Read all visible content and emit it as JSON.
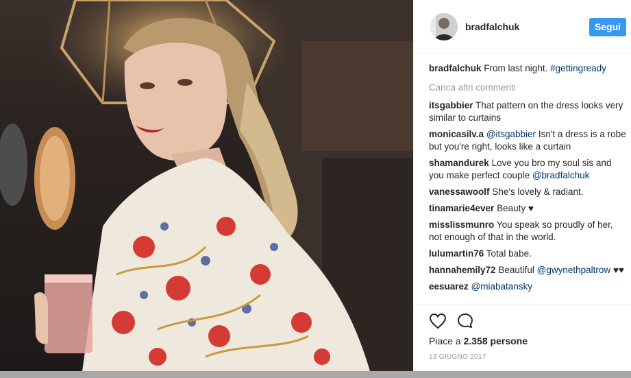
{
  "post": {
    "username": "bradfalchuk",
    "follow_label": "Segui",
    "caption_user": "bradfalchuk",
    "caption_text": "From last night. ",
    "caption_tag": "#gettingready",
    "load_more": "Carica altri commenti",
    "likes_prefix": "Piace a ",
    "likes_count": "2.358",
    "likes_suffix": " persone",
    "date": "13 GIUGNO 2017"
  },
  "comments": [
    {
      "user": "itsgabbier",
      "pre": "",
      "mention": "",
      "text": "That pattern on the dress looks very similar to curtains"
    },
    {
      "user": "monicasilv.a",
      "pre": "",
      "mention": "@itsgabbier",
      "text": " Isn't a dress is a robe but you're right, looks like a curtain"
    },
    {
      "user": "shamandurek",
      "pre": "Love you bro my soul sis and you make perfect couple ",
      "mention": "@bradfalchuk",
      "text": ""
    },
    {
      "user": "vanessawoolf",
      "pre": "",
      "mention": "",
      "text": "She's lovely & radiant."
    },
    {
      "user": "tinamarie4ever",
      "pre": "",
      "mention": "",
      "text": "Beauty ♥"
    },
    {
      "user": "misslissmunro",
      "pre": "",
      "mention": "",
      "text": "You speak so proudly of her, not enough of that in the world."
    },
    {
      "user": "lulumartin76",
      "pre": "",
      "mention": "",
      "text": "Total babe."
    },
    {
      "user": "hannahemily72",
      "pre": "Beautiful ",
      "mention": "@gwynethpaltrow",
      "text": " ♥♥"
    },
    {
      "user": "eesuarez",
      "pre": "",
      "mention": "@miabatansky",
      "text": ""
    }
  ],
  "icons": {
    "like": "heart-icon",
    "comment": "comment-bubble-icon",
    "accent": "#3897f0",
    "link": "#003569"
  }
}
